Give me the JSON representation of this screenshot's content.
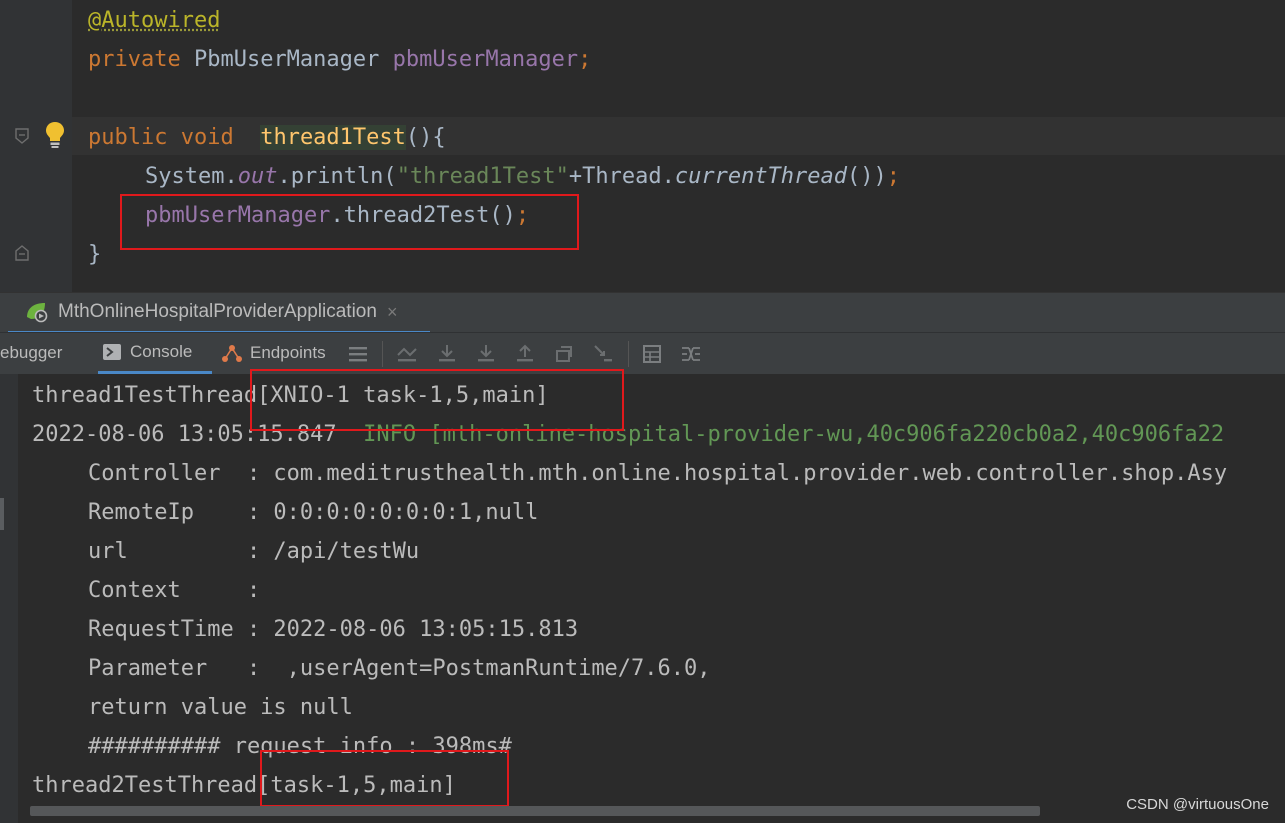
{
  "editor": {
    "annotation": "@Autowired",
    "field_decl": {
      "kw": "private ",
      "type": "PbmUserManager ",
      "name": "pbmUserManager",
      "semi": ";"
    },
    "method_decl": {
      "kw1": "public ",
      "kw2": "void",
      "gap": "  ",
      "name": "thread1Test",
      "sig": "(){"
    },
    "println": {
      "a": "System.",
      "out": "out",
      "b": ".println(",
      "str": "\"thread1Test\"",
      "c": "+Thread.",
      "cur": "currentThread",
      "d": "())",
      "semi": ";"
    },
    "call": {
      "field": "pbmUserManager",
      "rest": ".thread2Test()",
      "semi": ";"
    },
    "close_brace": "}"
  },
  "run_tab": {
    "label": "MthOnlineHospitalProviderApplication",
    "close": "×"
  },
  "toolbar": {
    "debugger_label": "ebugger",
    "console_label": "Console",
    "endpoints_label": "Endpoints"
  },
  "console": {
    "lines": [
      "thread1TestThread[XNIO-1 task-1,5,main]",
      "Controller  : com.meditrusthealth.mth.online.hospital.provider.web.controller.shop.Asy",
      "RemoteIp    : 0:0:0:0:0:0:0:1,null",
      "url         : /api/testWu",
      "Context     :",
      "RequestTime : 2022-08-06 13:05:15.813",
      "Parameter   :  ,userAgent=PostmanRuntime/7.6.0,",
      "return value is null",
      "########## request info : 398ms#",
      "thread2TestThread[task-1,5,main]"
    ],
    "log_timestamp": "2022-08-06 13:05:15.847",
    "log_info": "  INFO [mth-online-hospital-provider-wu,40c906fa220cb0a2,40c906fa22"
  },
  "watermark": "CSDN @virtuousOne",
  "colors": {
    "keyword": "#cc7832",
    "field": "#9876aa",
    "string": "#6a8759",
    "method": "#ffc66d",
    "annotation": "#bbb529",
    "accent": "#4a88c7",
    "highlight_box": "#e0191c"
  }
}
